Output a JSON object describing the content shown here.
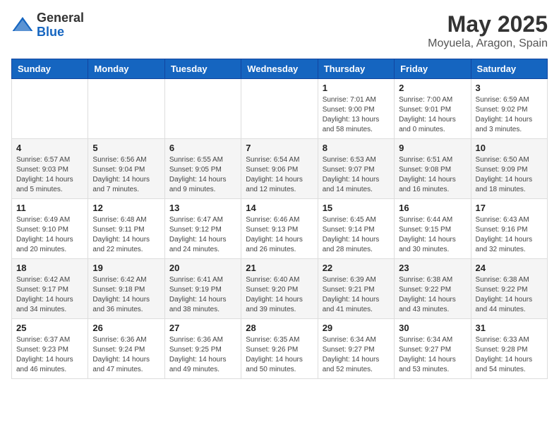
{
  "logo": {
    "general": "General",
    "blue": "Blue"
  },
  "header": {
    "month": "May 2025",
    "location": "Moyuela, Aragon, Spain"
  },
  "days_of_week": [
    "Sunday",
    "Monday",
    "Tuesday",
    "Wednesday",
    "Thursday",
    "Friday",
    "Saturday"
  ],
  "weeks": [
    [
      {
        "day": "",
        "info": ""
      },
      {
        "day": "",
        "info": ""
      },
      {
        "day": "",
        "info": ""
      },
      {
        "day": "",
        "info": ""
      },
      {
        "day": "1",
        "sunrise": "7:01 AM",
        "sunset": "9:00 PM",
        "daylight": "13 hours and 58 minutes."
      },
      {
        "day": "2",
        "sunrise": "7:00 AM",
        "sunset": "9:01 PM",
        "daylight": "14 hours and 0 minutes."
      },
      {
        "day": "3",
        "sunrise": "6:59 AM",
        "sunset": "9:02 PM",
        "daylight": "14 hours and 3 minutes."
      }
    ],
    [
      {
        "day": "4",
        "sunrise": "6:57 AM",
        "sunset": "9:03 PM",
        "daylight": "14 hours and 5 minutes."
      },
      {
        "day": "5",
        "sunrise": "6:56 AM",
        "sunset": "9:04 PM",
        "daylight": "14 hours and 7 minutes."
      },
      {
        "day": "6",
        "sunrise": "6:55 AM",
        "sunset": "9:05 PM",
        "daylight": "14 hours and 9 minutes."
      },
      {
        "day": "7",
        "sunrise": "6:54 AM",
        "sunset": "9:06 PM",
        "daylight": "14 hours and 12 minutes."
      },
      {
        "day": "8",
        "sunrise": "6:53 AM",
        "sunset": "9:07 PM",
        "daylight": "14 hours and 14 minutes."
      },
      {
        "day": "9",
        "sunrise": "6:51 AM",
        "sunset": "9:08 PM",
        "daylight": "14 hours and 16 minutes."
      },
      {
        "day": "10",
        "sunrise": "6:50 AM",
        "sunset": "9:09 PM",
        "daylight": "14 hours and 18 minutes."
      }
    ],
    [
      {
        "day": "11",
        "sunrise": "6:49 AM",
        "sunset": "9:10 PM",
        "daylight": "14 hours and 20 minutes."
      },
      {
        "day": "12",
        "sunrise": "6:48 AM",
        "sunset": "9:11 PM",
        "daylight": "14 hours and 22 minutes."
      },
      {
        "day": "13",
        "sunrise": "6:47 AM",
        "sunset": "9:12 PM",
        "daylight": "14 hours and 24 minutes."
      },
      {
        "day": "14",
        "sunrise": "6:46 AM",
        "sunset": "9:13 PM",
        "daylight": "14 hours and 26 minutes."
      },
      {
        "day": "15",
        "sunrise": "6:45 AM",
        "sunset": "9:14 PM",
        "daylight": "14 hours and 28 minutes."
      },
      {
        "day": "16",
        "sunrise": "6:44 AM",
        "sunset": "9:15 PM",
        "daylight": "14 hours and 30 minutes."
      },
      {
        "day": "17",
        "sunrise": "6:43 AM",
        "sunset": "9:16 PM",
        "daylight": "14 hours and 32 minutes."
      }
    ],
    [
      {
        "day": "18",
        "sunrise": "6:42 AM",
        "sunset": "9:17 PM",
        "daylight": "14 hours and 34 minutes."
      },
      {
        "day": "19",
        "sunrise": "6:42 AM",
        "sunset": "9:18 PM",
        "daylight": "14 hours and 36 minutes."
      },
      {
        "day": "20",
        "sunrise": "6:41 AM",
        "sunset": "9:19 PM",
        "daylight": "14 hours and 38 minutes."
      },
      {
        "day": "21",
        "sunrise": "6:40 AM",
        "sunset": "9:20 PM",
        "daylight": "14 hours and 39 minutes."
      },
      {
        "day": "22",
        "sunrise": "6:39 AM",
        "sunset": "9:21 PM",
        "daylight": "14 hours and 41 minutes."
      },
      {
        "day": "23",
        "sunrise": "6:38 AM",
        "sunset": "9:22 PM",
        "daylight": "14 hours and 43 minutes."
      },
      {
        "day": "24",
        "sunrise": "6:38 AM",
        "sunset": "9:22 PM",
        "daylight": "14 hours and 44 minutes."
      }
    ],
    [
      {
        "day": "25",
        "sunrise": "6:37 AM",
        "sunset": "9:23 PM",
        "daylight": "14 hours and 46 minutes."
      },
      {
        "day": "26",
        "sunrise": "6:36 AM",
        "sunset": "9:24 PM",
        "daylight": "14 hours and 47 minutes."
      },
      {
        "day": "27",
        "sunrise": "6:36 AM",
        "sunset": "9:25 PM",
        "daylight": "14 hours and 49 minutes."
      },
      {
        "day": "28",
        "sunrise": "6:35 AM",
        "sunset": "9:26 PM",
        "daylight": "14 hours and 50 minutes."
      },
      {
        "day": "29",
        "sunrise": "6:34 AM",
        "sunset": "9:27 PM",
        "daylight": "14 hours and 52 minutes."
      },
      {
        "day": "30",
        "sunrise": "6:34 AM",
        "sunset": "9:27 PM",
        "daylight": "14 hours and 53 minutes."
      },
      {
        "day": "31",
        "sunrise": "6:33 AM",
        "sunset": "9:28 PM",
        "daylight": "14 hours and 54 minutes."
      }
    ]
  ],
  "labels": {
    "sunrise": "Sunrise:",
    "sunset": "Sunset:",
    "daylight": "Daylight:"
  }
}
